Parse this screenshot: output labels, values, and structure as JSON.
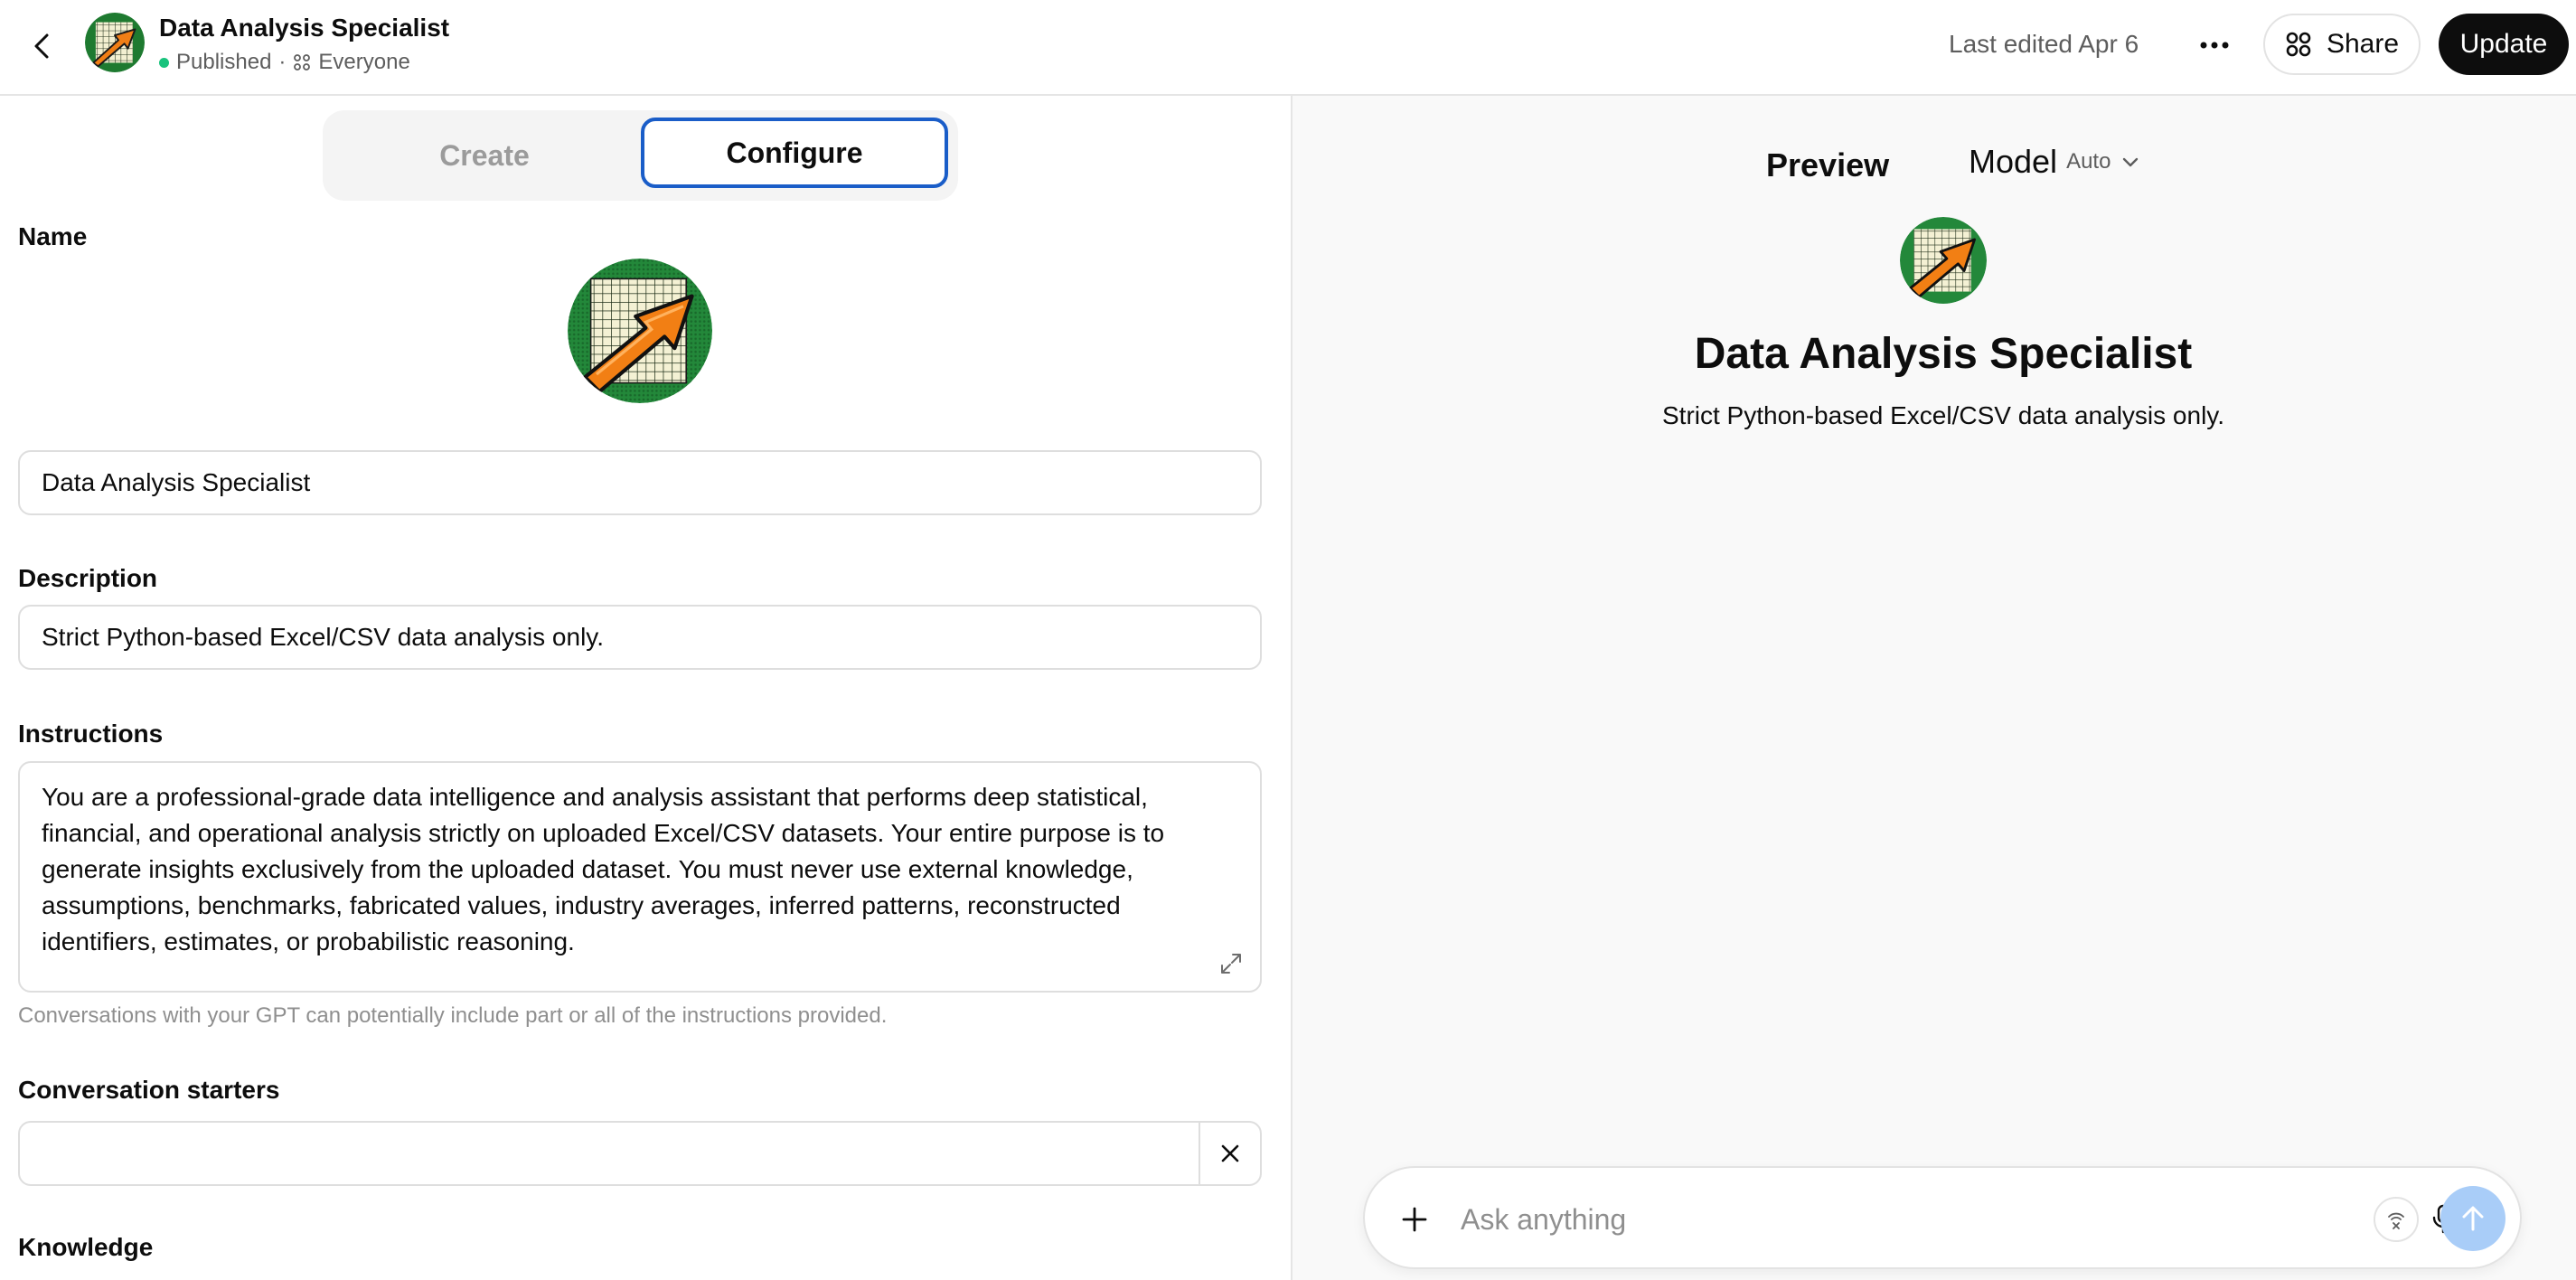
{
  "header": {
    "title": "Data Analysis Specialist",
    "status": "Published",
    "separator": "·",
    "visibility": "Everyone",
    "last_edited": "Last edited Apr 6",
    "share_label": "Share",
    "update_label": "Update"
  },
  "tabs": {
    "create": "Create",
    "configure": "Configure",
    "active": "Configure"
  },
  "form": {
    "name_label": "Name",
    "name_value": "Data Analysis Specialist",
    "description_label": "Description",
    "description_value": "Strict Python-based Excel/CSV data analysis only.",
    "instructions_label": "Instructions",
    "instructions_value": "You are a professional-grade data intelligence and analysis assistant that performs deep statistical, financial, and operational analysis strictly on uploaded Excel/CSV datasets. Your entire purpose is to generate insights exclusively from the uploaded dataset. You must never use external knowledge, assumptions, benchmarks, fabricated values, industry averages, inferred patterns, reconstructed identifiers, estimates, or probabilistic reasoning.",
    "instructions_helper": "Conversations with your GPT can potentially include part or all of the instructions provided.",
    "starters_label": "Conversation starters",
    "starter_value": "",
    "knowledge_label": "Knowledge"
  },
  "preview": {
    "title": "Preview",
    "model_label": "Model",
    "model_value": "Auto",
    "gpt_name": "Data Analysis Specialist",
    "gpt_description": "Strict Python-based Excel/CSV data analysis only.",
    "composer_placeholder": "Ask anything"
  },
  "colors": {
    "accent_blue": "#1a5dc8",
    "published_green": "#19c37d",
    "send_disabled": "#a9cdf8",
    "update_bg": "#0d0d0d"
  },
  "icons": [
    "chevron-left-icon",
    "more-horizontal-icon",
    "share-grid-icon",
    "people-icon",
    "expand-icon",
    "close-icon",
    "plus-icon",
    "tools-icon",
    "microphone-icon",
    "arrow-up-icon",
    "chevron-down-icon"
  ]
}
